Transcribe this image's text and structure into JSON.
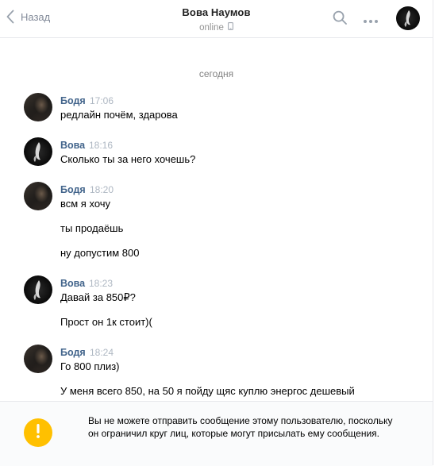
{
  "header": {
    "back_label": "Назад",
    "peer_name": "Вова Наумов",
    "peer_status": "online"
  },
  "history": {
    "date_label": "сегодня",
    "groups": [
      {
        "author": "Бодя",
        "time": "17:06",
        "messages": [
          "редлайн почём, здарова"
        ]
      },
      {
        "author": "Вова",
        "time": "18:16",
        "messages": [
          "Сколько ты за него хочешь?"
        ]
      },
      {
        "author": "Бодя",
        "time": "18:20",
        "messages": [
          "всм я хочу",
          "ты продаёшь",
          "ну допустим 800"
        ]
      },
      {
        "author": "Вова",
        "time": "18:23",
        "messages": [
          "Давай за 850₽?",
          "Прост он 1к стоит)("
        ]
      },
      {
        "author": "Бодя",
        "time": "18:24",
        "messages": [
          "Го 800 плиз)",
          "У меня всего 850, на 50 я пойду щяс куплю энергос дешевый"
        ]
      }
    ]
  },
  "footer": {
    "notice": "Вы не можете отправить сообщение этому пользователю, поскольку он ограничил круг лиц, которые могут присылать ему сообщения."
  },
  "icons": {
    "back": "chevron-left-icon",
    "search": "search-icon",
    "more": "more-dots-icon",
    "phone": "mobile-phone-icon",
    "warning": "exclamation-icon"
  },
  "colors": {
    "author_link": "#42648b",
    "muted": "#828a99",
    "warning": "#ffc000",
    "divider": "#e7e8ec"
  }
}
